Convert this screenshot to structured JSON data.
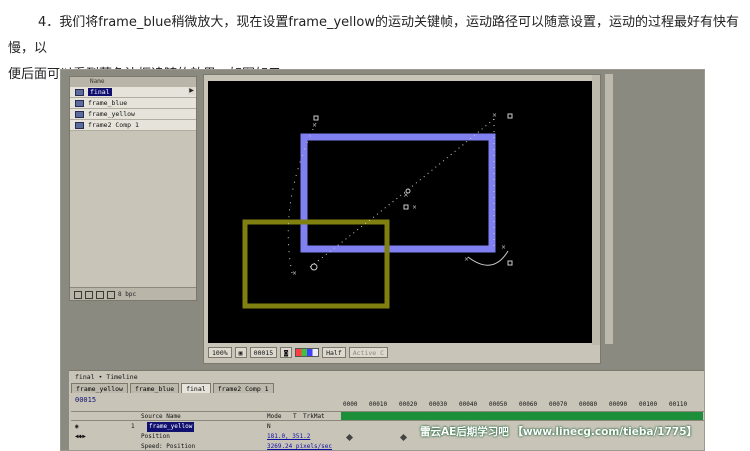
{
  "article": {
    "line1": "4．我们将frame_blue稍微放大，现在设置frame_yellow的运动关键帧，运动路径可以随意设置，运动的过程最好有快有慢，以",
    "line2": "便后面可以看到蓝色边框追随的效果。如图如示："
  },
  "project": {
    "header": "Name",
    "items": [
      {
        "label": "final"
      },
      {
        "label": "frame_blue"
      },
      {
        "label": "frame_yellow"
      },
      {
        "label": "frame2 Comp 1"
      }
    ],
    "footer_depth": "8 bpc"
  },
  "comp_toolbar": {
    "zoom": "100%",
    "timecode": "00015",
    "resolution": "Half",
    "camera": "Active C"
  },
  "timeline": {
    "title": "final • Timeline",
    "tabs": [
      "frame_yellow",
      "frame_blue",
      "final",
      "frame2 Comp 1"
    ],
    "active_tab": "final",
    "current_time": "00015",
    "ruler": [
      "0000",
      "00010",
      "00020",
      "00030",
      "00040",
      "00050",
      "00060",
      "00070",
      "00080",
      "00090",
      "00100",
      "00110"
    ],
    "columns": {
      "source_name": "Source Name",
      "mode": "Mode",
      "t": "T",
      "trkmat": "TrkMat"
    },
    "layer": {
      "index": "1",
      "name": "frame_yellow",
      "mode": "N"
    },
    "position": {
      "label": "Position",
      "value": "181.0, 351.2"
    },
    "speed": {
      "label": "Speed: Position",
      "value": "3269.24 pixels/sec"
    }
  },
  "watermark": "雷云AE后期学习吧 【www.linecg.com/tieba/1775】",
  "colors": {
    "frame_blue": "#8080f0",
    "frame_yellow": "#808010",
    "ae_panel": "#c8c4b8",
    "selection": "#101070"
  }
}
